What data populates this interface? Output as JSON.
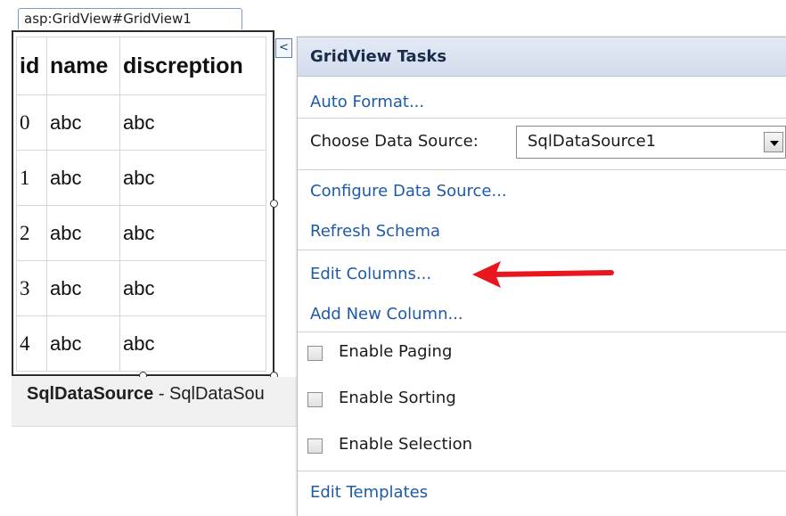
{
  "gridview": {
    "tag_label": "asp:GridView#GridView1",
    "columns": [
      "id",
      "name",
      "discreption"
    ],
    "rows": [
      [
        "0",
        "abc",
        "abc"
      ],
      [
        "1",
        "abc",
        "abc"
      ],
      [
        "2",
        "abc",
        "abc"
      ],
      [
        "3",
        "abc",
        "abc"
      ],
      [
        "4",
        "abc",
        "abc"
      ]
    ],
    "smart_tag_glyph": "<"
  },
  "datasource_bar": {
    "name": "SqlDataSource",
    "separator": " - ",
    "id": "SqlDataSou"
  },
  "tasks_panel": {
    "title": "GridView Tasks",
    "auto_format": "Auto Format...",
    "choose_ds_label": "Choose Data Source:",
    "choose_ds_value": "SqlDataSource1",
    "configure_ds": "Configure Data Source...",
    "refresh_schema": "Refresh Schema",
    "edit_columns": "Edit Columns...",
    "add_column": "Add New Column...",
    "enable_paging": "Enable Paging",
    "enable_sorting": "Enable Sorting",
    "enable_selection": "Enable Selection",
    "edit_templates": "Edit Templates"
  },
  "checkbox_states": {
    "paging": false,
    "sorting": false,
    "selection": false
  },
  "colors": {
    "link": "#1e5aa8",
    "annotation_arrow": "#e8171d",
    "header_bg": "#dbe3f0"
  },
  "icons": [
    "smart-tag-collapse-icon",
    "dropdown-arrow-icon",
    "red-arrow-annotation-icon"
  ]
}
